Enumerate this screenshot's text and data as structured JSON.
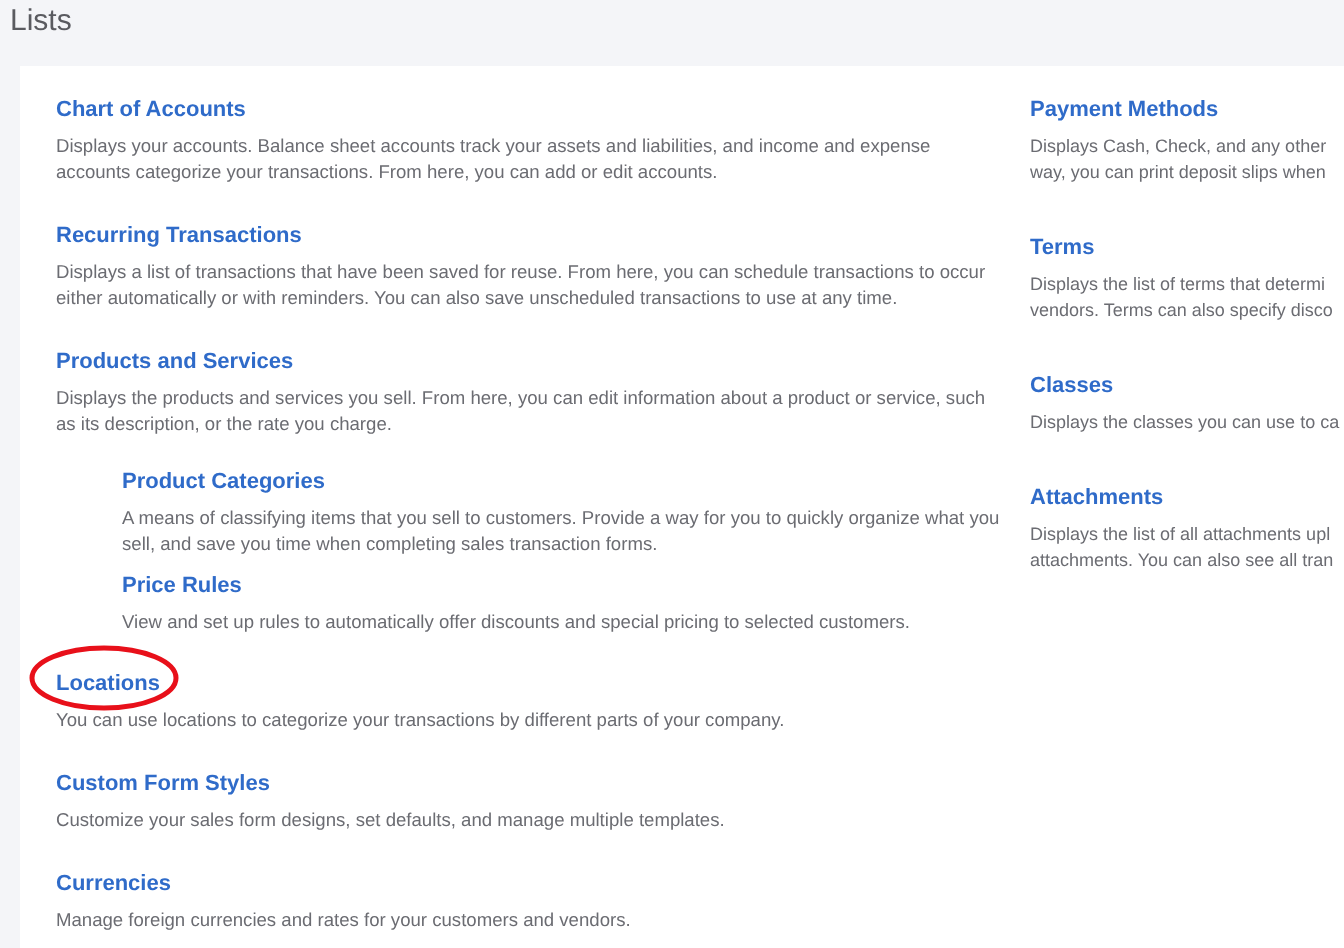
{
  "page_title": "Lists",
  "left_column": [
    {
      "title": "Chart of Accounts",
      "description": "Displays your accounts. Balance sheet accounts track your assets and liabilities, and income and expense accounts categorize your transactions. From here, you can add or edit accounts.",
      "circled": false
    },
    {
      "title": "Recurring Transactions",
      "description": "Displays a list of transactions that have been saved for reuse. From here, you can schedule transactions to occur either automatically or with reminders. You can also save unscheduled transactions to use at any time.",
      "circled": false
    },
    {
      "title": "Products and Services",
      "description": "Displays the products and services you sell. From here, you can edit information about a product or service, such as its description, or the rate you charge.",
      "circled": false,
      "children": [
        {
          "title": "Product Categories",
          "description": "A means of classifying items that you sell to customers. Provide a way for you to quickly organize what you sell, and save you time when completing sales transaction forms."
        },
        {
          "title": "Price Rules",
          "description": "View and set up rules to automatically offer discounts and special pricing to selected customers."
        }
      ]
    },
    {
      "title": "Locations",
      "description": "You can use locations to categorize your transactions by different parts of your company.",
      "circled": true
    },
    {
      "title": "Custom Form Styles",
      "description": "Customize your sales form designs, set defaults, and manage multiple templates.",
      "circled": false
    },
    {
      "title": "Currencies",
      "description": "Manage foreign currencies and rates for your customers and vendors.",
      "circled": false
    }
  ],
  "right_column": [
    {
      "title": "Payment Methods",
      "lines": [
        "Displays Cash, Check, and any other",
        "way, you can print deposit slips when"
      ]
    },
    {
      "title": "Terms",
      "lines": [
        "Displays the list of terms that determi",
        "vendors. Terms can also specify disco"
      ]
    },
    {
      "title": "Classes",
      "lines": [
        "Displays the classes you can use to ca"
      ]
    },
    {
      "title": "Attachments",
      "lines": [
        "Displays the list of all attachments upl",
        "attachments. You can also see all tran"
      ]
    }
  ]
}
